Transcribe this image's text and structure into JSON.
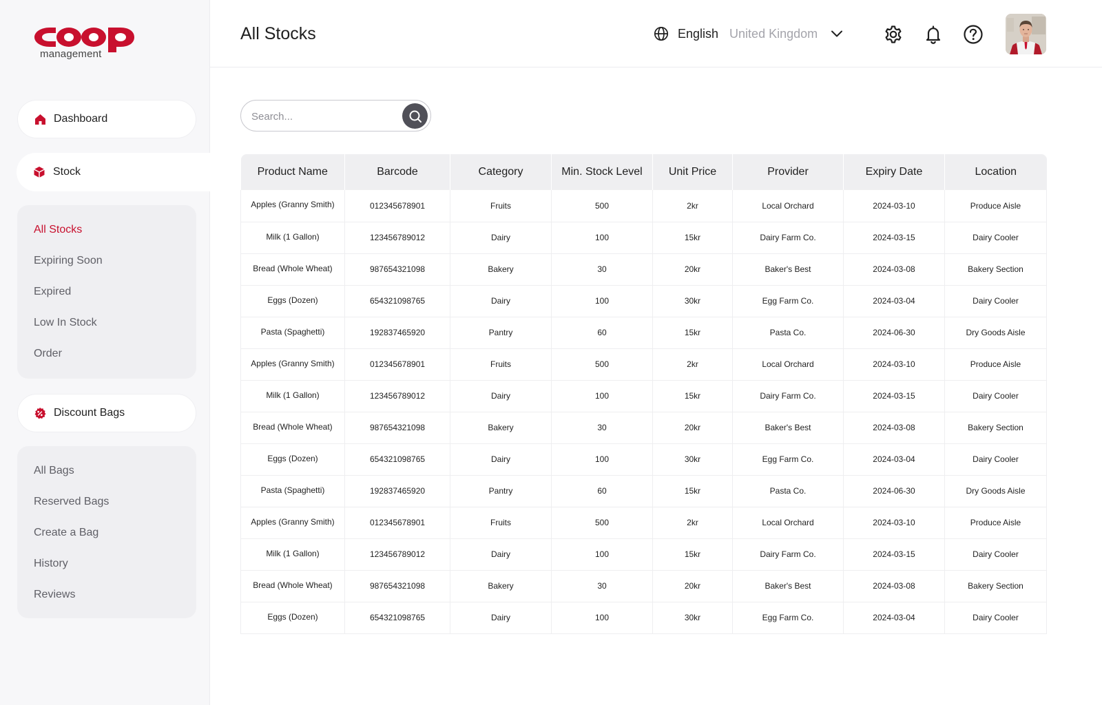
{
  "brand": {
    "logo_text": "coop",
    "logo_sub": "management",
    "accent": "#c8102e"
  },
  "nav": {
    "dashboard": {
      "label": "Dashboard",
      "icon": "home-icon"
    },
    "stock": {
      "label": "Stock",
      "icon": "box-icon"
    },
    "stock_items": [
      {
        "label": "All Stocks",
        "active": true
      },
      {
        "label": "Expiring Soon",
        "active": false
      },
      {
        "label": "Expired",
        "active": false
      },
      {
        "label": "Low In Stock",
        "active": false
      },
      {
        "label": "Order",
        "active": false
      }
    ],
    "discount": {
      "label": "Discount Bags",
      "icon": "discount-badge-icon"
    },
    "bag_items": [
      {
        "label": "All Bags"
      },
      {
        "label": "Reserved Bags"
      },
      {
        "label": "Create a Bag"
      },
      {
        "label": "History"
      },
      {
        "label": "Reviews"
      }
    ]
  },
  "header": {
    "title": "All Stocks",
    "language": "English",
    "region": "United Kingdom",
    "icons": [
      "globe-icon",
      "gear-icon",
      "bell-icon",
      "help-icon",
      "avatar"
    ]
  },
  "search": {
    "placeholder": "Search..."
  },
  "table": {
    "columns": [
      "Product Name",
      "Barcode",
      "Category",
      "Min. Stock Level",
      "Unit Price",
      "Provider",
      "Expiry Date",
      "Location"
    ],
    "rows": [
      [
        "Apples (Granny Smith)",
        "012345678901",
        "Fruits",
        "500",
        "2kr",
        "Local Orchard",
        "2024-03-10",
        "Produce Aisle"
      ],
      [
        "Milk (1 Gallon)",
        "123456789012",
        "Dairy",
        "100",
        "15kr",
        "Dairy Farm Co.",
        "2024-03-15",
        "Dairy Cooler"
      ],
      [
        "Bread (Whole Wheat)",
        "987654321098",
        "Bakery",
        "30",
        "20kr",
        "Baker's Best",
        "2024-03-08",
        "Bakery Section"
      ],
      [
        "Eggs (Dozen)",
        "654321098765",
        "Dairy",
        "100",
        "30kr",
        "Egg Farm Co.",
        "2024-03-04",
        "Dairy Cooler"
      ],
      [
        "Pasta (Spaghetti)",
        "192837465920",
        "Pantry",
        "60",
        "15kr",
        "Pasta Co.",
        "2024-06-30",
        "Dry Goods Aisle"
      ],
      [
        "Apples (Granny Smith)",
        "012345678901",
        "Fruits",
        "500",
        "2kr",
        "Local Orchard",
        "2024-03-10",
        "Produce Aisle"
      ],
      [
        "Milk (1 Gallon)",
        "123456789012",
        "Dairy",
        "100",
        "15kr",
        "Dairy Farm Co.",
        "2024-03-15",
        "Dairy Cooler"
      ],
      [
        "Bread (Whole Wheat)",
        "987654321098",
        "Bakery",
        "30",
        "20kr",
        "Baker's Best",
        "2024-03-08",
        "Bakery Section"
      ],
      [
        "Eggs (Dozen)",
        "654321098765",
        "Dairy",
        "100",
        "30kr",
        "Egg Farm Co.",
        "2024-03-04",
        "Dairy Cooler"
      ],
      [
        "Pasta (Spaghetti)",
        "192837465920",
        "Pantry",
        "60",
        "15kr",
        "Pasta Co.",
        "2024-06-30",
        "Dry Goods Aisle"
      ],
      [
        "Apples (Granny Smith)",
        "012345678901",
        "Fruits",
        "500",
        "2kr",
        "Local Orchard",
        "2024-03-10",
        "Produce Aisle"
      ],
      [
        "Milk (1 Gallon)",
        "123456789012",
        "Dairy",
        "100",
        "15kr",
        "Dairy Farm Co.",
        "2024-03-15",
        "Dairy Cooler"
      ],
      [
        "Bread (Whole Wheat)",
        "987654321098",
        "Bakery",
        "30",
        "20kr",
        "Baker's Best",
        "2024-03-08",
        "Bakery Section"
      ],
      [
        "Eggs (Dozen)",
        "654321098765",
        "Dairy",
        "100",
        "30kr",
        "Egg Farm Co.",
        "2024-03-04",
        "Dairy Cooler"
      ]
    ]
  }
}
